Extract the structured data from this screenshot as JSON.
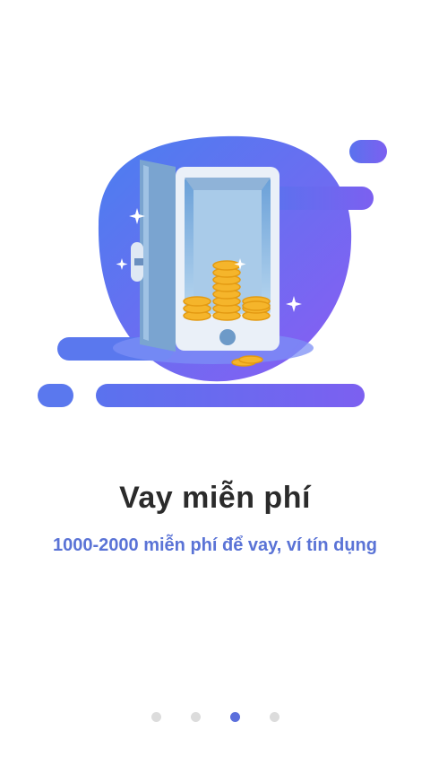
{
  "slide": {
    "title": "Vay miễn phí",
    "subtitle": "1000-2000 miễn phí để vay, ví tín dụng",
    "illustration_icon": "safe-with-coins-icon"
  },
  "pager": {
    "total": 4,
    "active_index": 2
  },
  "colors": {
    "accent": "#5b6fdc",
    "title": "#2b2b2b",
    "subtitle": "#5a73d6",
    "dot_inactive": "#dcdcdc"
  }
}
